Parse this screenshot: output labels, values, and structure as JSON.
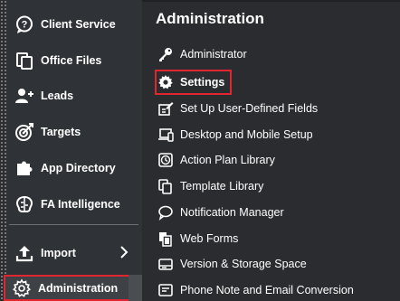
{
  "sidebar": {
    "items": [
      {
        "label": "Client Service",
        "icon": "chat-question-icon"
      },
      {
        "label": "Office Files",
        "icon": "files-icon"
      },
      {
        "label": "Leads",
        "icon": "leads-icon"
      },
      {
        "label": "Targets",
        "icon": "target-icon"
      },
      {
        "label": "App Directory",
        "icon": "puzzle-icon"
      },
      {
        "label": "FA Intelligence",
        "icon": "brain-icon"
      },
      {
        "label": "Import",
        "icon": "upload-icon"
      },
      {
        "label": "Administration",
        "icon": "gear-icon"
      }
    ]
  },
  "panel": {
    "title": "Administration",
    "items": [
      {
        "label": "Administrator",
        "icon": "key-icon"
      },
      {
        "label": "Settings",
        "icon": "gear-icon"
      },
      {
        "label": "Set Up User-Defined Fields",
        "icon": "edit-fields-icon"
      },
      {
        "label": "Desktop and Mobile Setup",
        "icon": "devices-icon"
      },
      {
        "label": "Action Plan Library",
        "icon": "clock-icon"
      },
      {
        "label": "Template Library",
        "icon": "copy-icon"
      },
      {
        "label": "Notification Manager",
        "icon": "speech-bubble-icon"
      },
      {
        "label": "Web Forms",
        "icon": "forms-icon"
      },
      {
        "label": "Version & Storage Space",
        "icon": "storage-icon"
      },
      {
        "label": "Phone Note and Email Conversion",
        "icon": "note-icon"
      }
    ]
  },
  "colors": {
    "highlight": "#e0262e",
    "background": "#2a2c30"
  }
}
